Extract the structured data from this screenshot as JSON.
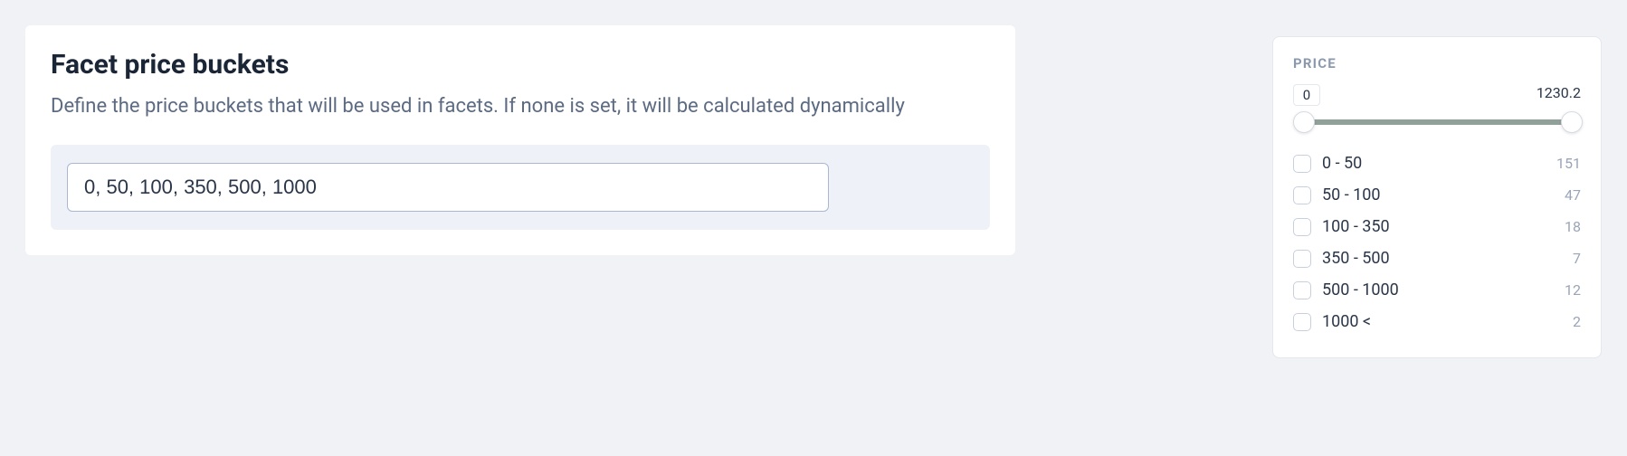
{
  "left_card": {
    "title": "Facet price buckets",
    "description": "Define the price buckets that will be used in facets. If none is set, it will be calculated dynamically",
    "input_value": "0, 50, 100, 350, 500, 1000"
  },
  "right_card": {
    "title": "PRICE",
    "slider": {
      "min": "0",
      "max": "1230.2"
    },
    "buckets": [
      {
        "label": "0 - 50",
        "count": "151"
      },
      {
        "label": "50 - 100",
        "count": "47"
      },
      {
        "label": "100 - 350",
        "count": "18"
      },
      {
        "label": "350 - 500",
        "count": "7"
      },
      {
        "label": "500 - 1000",
        "count": "12"
      },
      {
        "label": "1000 <",
        "count": "2"
      }
    ]
  }
}
